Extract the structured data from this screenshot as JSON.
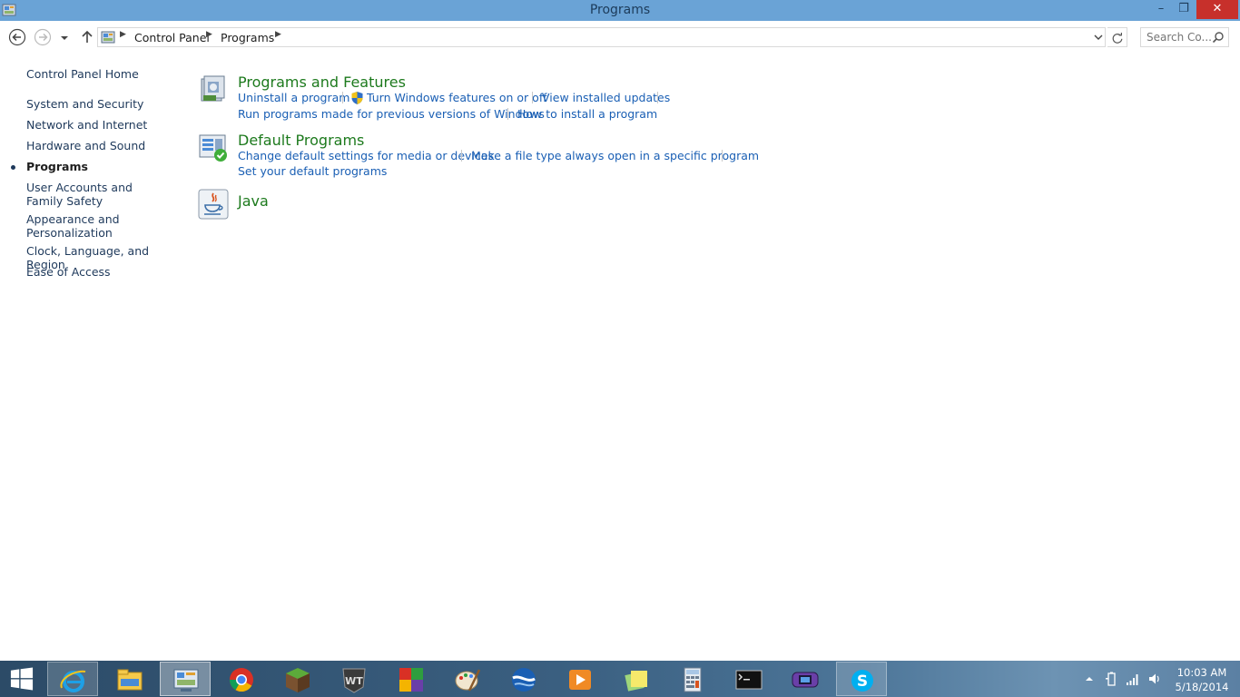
{
  "window": {
    "title": "Programs",
    "minimize_glyph": "–",
    "maximize_glyph": "❐",
    "close_glyph": "✕"
  },
  "address": {
    "crumbs": [
      "Control Panel",
      "Programs"
    ],
    "search_placeholder": "Search Co..."
  },
  "sidebar": {
    "items": [
      {
        "label": "Control Panel Home"
      },
      {
        "label": "System and Security"
      },
      {
        "label": "Network and Internet"
      },
      {
        "label": "Hardware and Sound"
      },
      {
        "label": "Programs",
        "active": true
      },
      {
        "label": "User Accounts and Family Safety"
      },
      {
        "label": "Appearance and Personalization"
      },
      {
        "label": "Clock, Language, and Region"
      },
      {
        "label": "Ease of Access"
      }
    ]
  },
  "categories": [
    {
      "title": "Programs and Features",
      "icon": "programs-features-icon",
      "links": [
        "Uninstall a program",
        "Turn Windows features on or off",
        "View installed updates",
        "Run programs made for previous versions of Windows",
        "How to install a program"
      ]
    },
    {
      "title": "Default Programs",
      "icon": "default-programs-icon",
      "links": [
        "Change default settings for media or devices",
        "Make a file type always open in a specific program",
        "Set your default programs"
      ]
    },
    {
      "title": "Java",
      "icon": "java-icon",
      "links": []
    }
  ],
  "taskbar": {
    "apps": [
      "internet-explorer-icon",
      "file-explorer-icon",
      "control-panel-icon",
      "chrome-icon",
      "minecraft-icon",
      "world-of-tanks-icon",
      "color-squares-icon",
      "paint-icon",
      "google-earth-icon",
      "media-player-icon",
      "sticky-notes-icon",
      "calculator-icon",
      "command-prompt-icon",
      "gamepad-icon",
      "skype-icon"
    ],
    "time": "10:03 AM",
    "date": "5/18/2014"
  },
  "colors": {
    "titlebar": "#6aa3d6",
    "link": "#1a5fb4",
    "heading": "#1d7a1d",
    "close": "#c7302b"
  }
}
